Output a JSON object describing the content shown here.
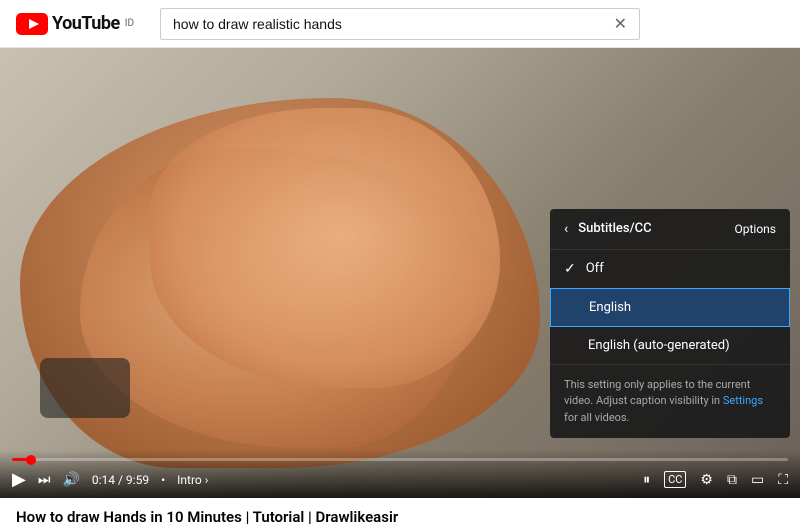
{
  "header": {
    "youtube_label": "YouTube",
    "country_code": "ID",
    "search_value": "how to draw realistic hands",
    "clear_button_label": "✕"
  },
  "video": {
    "progress_time": "0:14 / 9:59",
    "separator": "•",
    "chapter": "Intro",
    "chapter_arrow": "›"
  },
  "controls": {
    "play_icon": "▶",
    "skip_icon": "⏭",
    "volume_icon": "🔊",
    "pause_icon": "⏸",
    "captions_icon": "CC",
    "settings_icon": "⚙",
    "miniplayer_icon": "⧉",
    "theater_icon": "▭",
    "fullscreen_icon": "⛶"
  },
  "subtitles_panel": {
    "back_icon": "‹",
    "title": "Subtitles/CC",
    "options_label": "Options",
    "items": [
      {
        "id": "off",
        "label": "Off",
        "checked": true,
        "active": false
      },
      {
        "id": "english",
        "label": "English",
        "checked": false,
        "active": true
      },
      {
        "id": "english-auto",
        "label": "English (auto-generated)",
        "checked": false,
        "active": false
      }
    ],
    "note": "This setting only applies to the current video. Adjust caption visibility in",
    "settings_link": "Settings",
    "note_end": "for all videos."
  },
  "page": {
    "video_title": "How to draw Hands in 10 Minutes | Tutorial | Drawlikeasir"
  }
}
